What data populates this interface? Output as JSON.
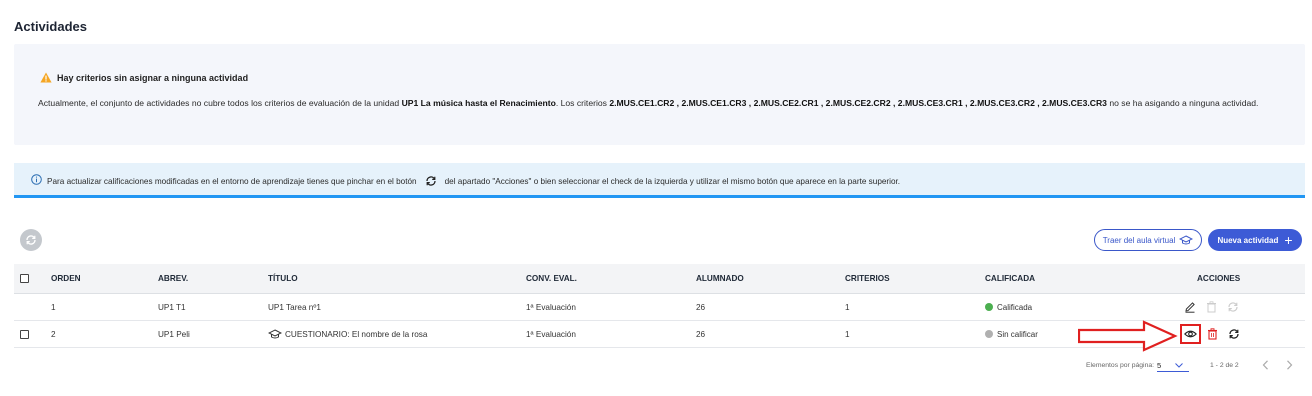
{
  "page": {
    "title": "Actividades"
  },
  "warning": {
    "title": "Hay criterios sin asignar a ninguna actividad",
    "text_1": "Actualmente, el conjunto de actividades no cubre todos los criterios de evaluación de la unidad ",
    "unit_bold": "UP1 La música hasta el Renacimiento",
    "text_2": ". Los criterios ",
    "criteria_bold": "2.MUS.CE1.CR2 , 2.MUS.CE1.CR3 , 2.MUS.CE2.CR1 , 2.MUS.CE2.CR2 , 2.MUS.CE3.CR1 , 2.MUS.CE3.CR2 , 2.MUS.CE3.CR3",
    "text_3": " no se ha asigando a ninguna actividad."
  },
  "info": {
    "text_before": "Para actualizar calificaciones modificadas en el entorno de aprendizaje tienes que pinchar en el botón",
    "text_after": "del apartado \"Acciones\" o bien seleccionar el check de la izquierda y utilizar el mismo botón que aparece en la parte superior."
  },
  "toolbar": {
    "bring_label": "Traer del aula virtual",
    "new_label": "Nueva actividad",
    "new_plus": "+"
  },
  "table": {
    "headers": {
      "orden": "ORDEN",
      "abrev": "ABREV.",
      "titulo": "TÍTULO",
      "conv": "CONV. EVAL.",
      "alumnado": "ALUMNADO",
      "criterios": "CRITERIOS",
      "calificada": "CALIFICADA",
      "acciones": "ACCIONES"
    },
    "rows": [
      {
        "orden": "1",
        "abrev": "UP1 T1",
        "titulo": "UP1 Tarea nº1",
        "conv": "1ª Evaluación",
        "alumnado": "26",
        "criterios": "1",
        "calificada": "Calificada",
        "status_color": "#4caf50",
        "checkbox": false,
        "title_icon": ""
      },
      {
        "orden": "2",
        "abrev": "UP1 Peli",
        "titulo": "CUESTIONARIO: El nombre de la rosa",
        "conv": "1ª Evaluación",
        "alumnado": "26",
        "criterios": "1",
        "calificada": "Sin calificar",
        "status_color": "#b0b0b0",
        "checkbox": true,
        "title_icon": "graduation-cap-icon"
      }
    ]
  },
  "pagination": {
    "label": "Elementos por página:",
    "page_size": "5",
    "range": "1 - 2 de 2"
  },
  "colors": {
    "primary": "#3d5bd6",
    "info_accent": "#2196f3",
    "danger": "#e02020",
    "warning": "#f5a623"
  }
}
